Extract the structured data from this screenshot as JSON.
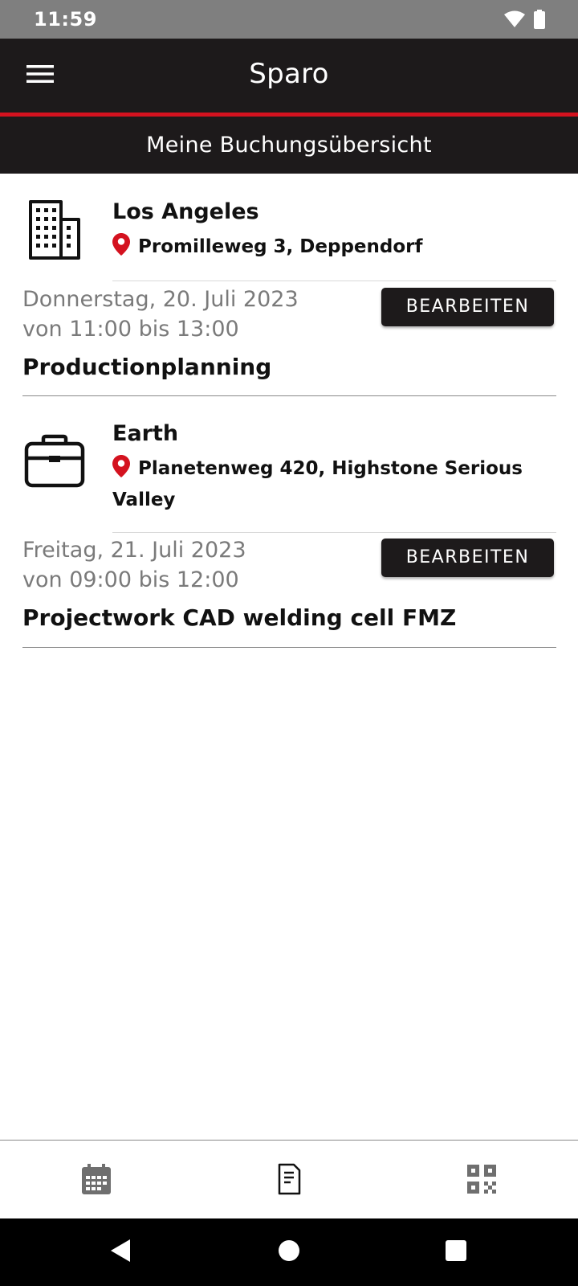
{
  "status_bar": {
    "time": "11:59",
    "icons": [
      "wifi-icon",
      "battery-icon"
    ]
  },
  "app_bar": {
    "title": "Sparo",
    "menu_icon": "hamburger-menu-icon"
  },
  "sub_header": {
    "title": "Meine Buchungsübersicht"
  },
  "bookings": [
    {
      "icon": "building-icon",
      "location": "Los Angeles",
      "address": "Promilleweg 3, Deppendorf",
      "date": "Donnerstag, 20. Juli 2023",
      "time": "von 11:00 bis 13:00",
      "title": "Productionplanning",
      "edit_label": "BEARBEITEN"
    },
    {
      "icon": "briefcase-icon",
      "location": "Earth",
      "address": "Planetenweg 420, Highstone Serious Valley",
      "date": "Freitag, 21. Juli 2023",
      "time": "von 09:00 bis 12:00",
      "title": "Projectwork CAD welding cell FMZ",
      "edit_label": "BEARBEITEN"
    }
  ],
  "bottom_nav": {
    "items": [
      "calendar-icon",
      "document-icon",
      "qr-code-icon"
    ]
  },
  "system_nav": {
    "items": [
      "back-icon",
      "home-icon",
      "recents-icon"
    ]
  },
  "colors": {
    "header_bg": "#1d1a1b",
    "accent_red": "#d4121f",
    "status_bar_bg": "#7f7f7f",
    "date_text": "#7a7a7a",
    "nav_icon": "#6f6f6f"
  }
}
